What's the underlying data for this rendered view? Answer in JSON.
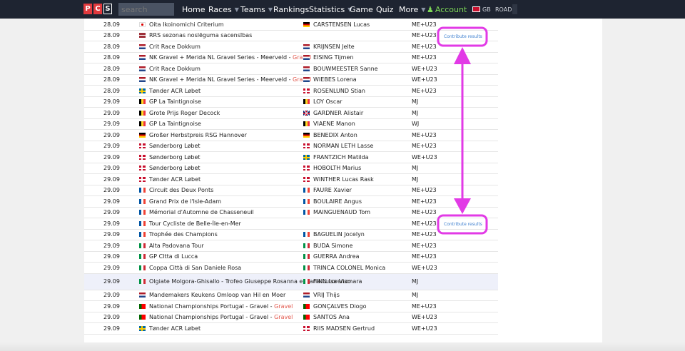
{
  "nav": {
    "logo": [
      "P",
      "C",
      "S"
    ],
    "search_placeholder": "search",
    "items": [
      {
        "label": "Home",
        "dropdown": false
      },
      {
        "label": "Races",
        "dropdown": true
      },
      {
        "label": "Teams",
        "dropdown": true
      },
      {
        "label": "Rankings",
        "dropdown": false
      },
      {
        "label": "Statistics",
        "dropdown": true
      },
      {
        "label": "Game",
        "dropdown": false
      },
      {
        "label": "Quiz",
        "dropdown": false
      },
      {
        "label": "More",
        "dropdown": true
      }
    ],
    "account": "Account",
    "lang": "GB",
    "mode": "ROAD"
  },
  "rows": [
    {
      "date": "28.09",
      "flag": "jp",
      "race": "Oita Ikoinomichi Criterium",
      "rider_flag": "de",
      "rider": "CARSTENSEN Lucas",
      "class": "ME+U23"
    },
    {
      "date": "28.09",
      "flag": "lv",
      "race": "RRS sezonas noslēguma sacensības",
      "rider_flag": "",
      "rider": "",
      "class": "ME+U23",
      "contribute": "Contribute results"
    },
    {
      "date": "28.09",
      "flag": "nl",
      "race": "Crit Race Dokkum",
      "rider_flag": "nl",
      "rider": "KRIJNSEN Jelte",
      "class": "ME+U23"
    },
    {
      "date": "28.09",
      "flag": "nl",
      "race": "NK Gravel + Merida NL Gravel Series - Meerveld - ",
      "gravel": "Gravel",
      "rider_flag": "nl",
      "rider": "EISING Tijmen",
      "class": "ME+U23"
    },
    {
      "date": "28.09",
      "flag": "nl",
      "race": "Crit Race Dokkum",
      "rider_flag": "nl",
      "rider": "BOUWMEESTER Sanne",
      "class": "WE+U23"
    },
    {
      "date": "28.09",
      "flag": "nl",
      "race": "NK Gravel + Merida NL Gravel Series - Meerveld - ",
      "gravel": "Gravel",
      "rider_flag": "nl",
      "rider": "WIEBES Lorena",
      "class": "WE+U23"
    },
    {
      "date": "28.09",
      "flag": "se",
      "race": "Tønder ACR Løbet",
      "rider_flag": "dk",
      "rider": "ROSENLUND Stian",
      "class": "ME+U23"
    },
    {
      "date": "29.09",
      "flag": "be",
      "race": "GP La Taintignoise",
      "rider_flag": "be",
      "rider": "LOY Oscar",
      "class": "MJ"
    },
    {
      "date": "29.09",
      "flag": "be",
      "race": "Grote Prijs Roger Decock",
      "rider_flag": "gb",
      "rider": "GARDNER Alistair",
      "class": "MJ"
    },
    {
      "date": "29.09",
      "flag": "be",
      "race": "GP La Taintignoise",
      "rider_flag": "be",
      "rider": "VIAENE Manon",
      "class": "WJ"
    },
    {
      "date": "29.09",
      "flag": "de",
      "race": "Großer Herbstpreis RSG Hannover",
      "rider_flag": "de",
      "rider": "BENEDIX Anton",
      "class": "ME+U23"
    },
    {
      "date": "29.09",
      "flag": "dk",
      "race": "Sønderborg Løbet",
      "rider_flag": "dk",
      "rider": "NORMAN LETH Lasse",
      "class": "ME+U23"
    },
    {
      "date": "29.09",
      "flag": "dk",
      "race": "Sønderborg Løbet",
      "rider_flag": "se",
      "rider": "FRANTZICH Matilda",
      "class": "WE+U23"
    },
    {
      "date": "29.09",
      "flag": "dk",
      "race": "Sønderborg Løbet",
      "rider_flag": "dk",
      "rider": "HOBOLTH Marius",
      "class": "MJ"
    },
    {
      "date": "29.09",
      "flag": "dk",
      "race": "Tønder ACR Løbet",
      "rider_flag": "dk",
      "rider": "WINTHER Lucas Rask",
      "class": "MJ"
    },
    {
      "date": "29.09",
      "flag": "fr",
      "race": "Circuit des Deux Ponts",
      "rider_flag": "fr",
      "rider": "FAURE Xavier",
      "class": "ME+U23"
    },
    {
      "date": "29.09",
      "flag": "fr",
      "race": "Grand Prix de l'Isle-Adam",
      "rider_flag": "fr",
      "rider": "BOULAIRE Angus",
      "class": "ME+U23"
    },
    {
      "date": "29.09",
      "flag": "fr",
      "race": "Mémorial d'Automne de Chasseneuil",
      "rider_flag": "fr",
      "rider": "MAINGUENAUD Tom",
      "class": "ME+U23"
    },
    {
      "date": "29.09",
      "flag": "fr",
      "race": "Tour Cycliste de Belle-Île-en-Mer",
      "rider_flag": "",
      "rider": "",
      "class": "ME+U23",
      "contribute": "Contribute results"
    },
    {
      "date": "29.09",
      "flag": "fr",
      "race": "Trophée des Champions",
      "rider_flag": "fr",
      "rider": "BAGUELIN Jocelyn",
      "class": "ME+U23"
    },
    {
      "date": "29.09",
      "flag": "it",
      "race": "Alta Padovana Tour",
      "rider_flag": "it",
      "rider": "BUDA Simone",
      "class": "ME+U23"
    },
    {
      "date": "29.09",
      "flag": "it",
      "race": "GP CItta di Lucca",
      "rider_flag": "it",
      "rider": "GUERRA Andrea",
      "class": "ME+U23"
    },
    {
      "date": "29.09",
      "flag": "it",
      "race": "Coppa Città di San Daniele Rosa",
      "rider_flag": "it",
      "rider": "TRINCA COLONEL Monica",
      "class": "WE+U23"
    },
    {
      "date": "29.09",
      "flag": "it",
      "race": "Olgiate Molgora-Ghisallo - Trofeo Giuseppe Rosanna e Maria Luisa Vismara",
      "rider_flag": "it",
      "rider": "FINN Lorenzo",
      "class": "MJ",
      "tall": true
    },
    {
      "date": "29.09",
      "flag": "nl",
      "race": "Mandemakers Keukens Omloop van Hil en Moer",
      "rider_flag": "nl",
      "rider": "VRIJ Thijs",
      "class": "MJ"
    },
    {
      "date": "29.09",
      "flag": "pt",
      "race": "National Championships Portugal - Gravel - ",
      "gravel": "Gravel",
      "rider_flag": "pt",
      "rider": "GONÇALVES Diogo",
      "class": "ME+U23"
    },
    {
      "date": "29.09",
      "flag": "pt",
      "race": "National Championships Portugal - Gravel - ",
      "gravel": "Gravel",
      "rider_flag": "pt",
      "rider": "SANTOS Ana",
      "class": "WE+U23"
    },
    {
      "date": "29.09",
      "flag": "se",
      "race": "Tønder ACR Løbet",
      "rider_flag": "dk",
      "rider": "RIIS MADSEN Gertrud",
      "class": "WE+U23"
    }
  ],
  "colors": {
    "topbar": "#1e2431",
    "highlight": "#e23ae6",
    "link": "#3d7fcf",
    "gravel": "#e2574c"
  }
}
